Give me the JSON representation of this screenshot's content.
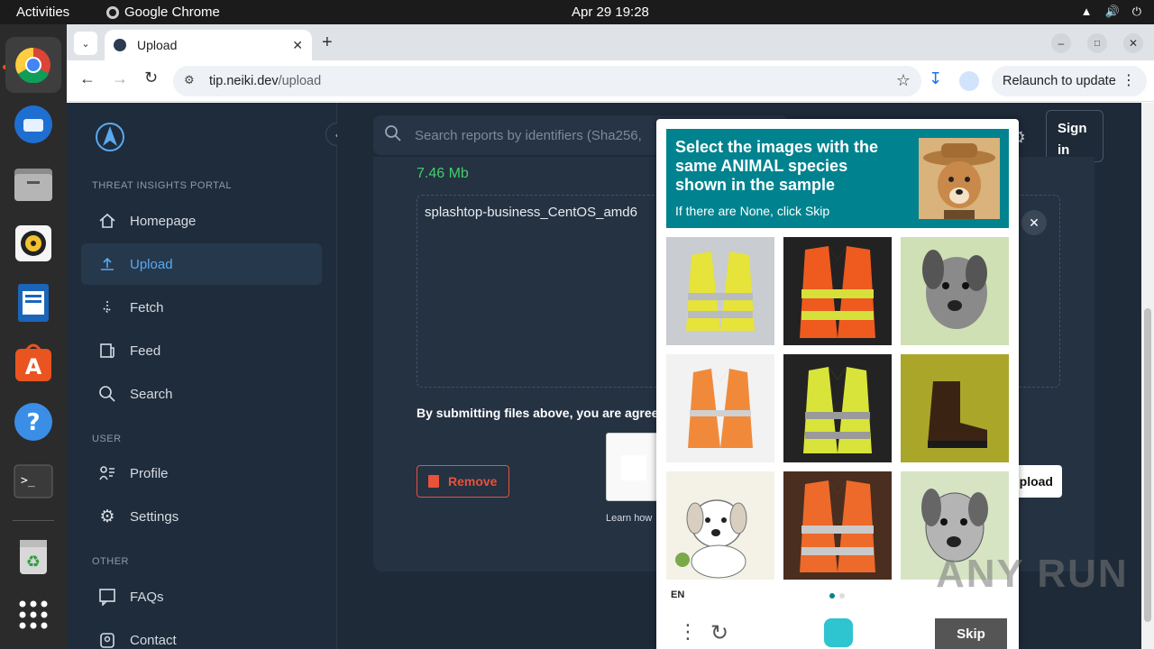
{
  "os": {
    "activities": "Activities",
    "app_name": "Google Chrome",
    "clock": "Apr 29  19:28"
  },
  "browser": {
    "tab_title": "Upload",
    "url_domain": "tip.neiki.dev",
    "url_path": "/upload",
    "relaunch_label": "Relaunch to update"
  },
  "sidebar": {
    "section_portal": "THREAT INSIGHTS PORTAL",
    "section_user": "USER",
    "section_other": "OTHER",
    "items": [
      {
        "label": "Homepage"
      },
      {
        "label": "Upload"
      },
      {
        "label": "Fetch"
      },
      {
        "label": "Feed"
      },
      {
        "label": "Search"
      },
      {
        "label": "Profile"
      },
      {
        "label": "Settings"
      },
      {
        "label": "FAQs"
      },
      {
        "label": "Contact"
      }
    ]
  },
  "main": {
    "search_placeholder": "Search reports by identifiers (Sha256,",
    "signin_label": "Sign in",
    "file_size": "7.46 Mb",
    "file_name": "splashtop-business_CentOS_amd6",
    "terms_text": "By submitting files above, you are agreei",
    "remove_label": "Remove",
    "upload_label": "Upload",
    "learn_text": "Learn how"
  },
  "captcha": {
    "title": "Select the images with the same ANIMAL species shown in the sample",
    "subtitle": "If there are None, click Skip",
    "language": "EN",
    "skip_label": "Skip",
    "grid": [
      "yellow-vest",
      "orange-vest",
      "dog-sketch",
      "orange-vest-sketch",
      "yellow-vest",
      "boot",
      "puppy-sketch",
      "orange-vest",
      "dog-sketch"
    ],
    "sample": "dog-with-cowboy-hat"
  },
  "watermark": "ANY RUN",
  "colors": {
    "accent": "#59a9f0",
    "captcha_header": "#00838f",
    "remove_red": "#e8513a",
    "success_green": "#3fcf6a"
  }
}
